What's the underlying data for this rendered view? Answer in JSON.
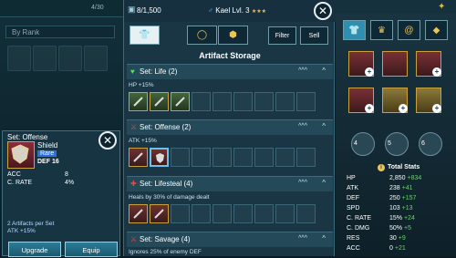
{
  "left_panel": {
    "top_counter": "4/30",
    "sort_label": "By Rank"
  },
  "detail": {
    "title": "Set: Offense",
    "item_name": "Shield",
    "rarity": "Rare",
    "main_stat": "DEF 16",
    "stats": [
      {
        "label": "ACC",
        "value": "8"
      },
      {
        "label": "C. RATE",
        "value": "4%"
      }
    ],
    "set_pieces": "2 Artifacts per Set",
    "set_bonus": "ATK +15%",
    "upgrade_label": "Upgrade",
    "equip_label": "Equip",
    "close_glyph": "✕"
  },
  "storage": {
    "bag_count": "8/1,500",
    "champion": "Kael Lvl. 3",
    "champion_stars": "★★★",
    "close_glyph": "✕",
    "filter_label": "Filter",
    "sell_label": "Sell",
    "title": "Artifact Storage",
    "sets": [
      {
        "name": "Set: Life (2)",
        "bonus": "HP +15%",
        "icon": "heart-icon",
        "icon_color": "#5fdc5f"
      },
      {
        "name": "Set: Offense (2)",
        "bonus": "ATK +15%",
        "icon": "sword-icon",
        "icon_color": "#e44b4b"
      },
      {
        "name": "Set: Lifesteal (4)",
        "bonus": "Heals by 30% of damage dealt",
        "icon": "drop-icon",
        "icon_color": "#e44b4b"
      },
      {
        "name": "Set: Savage (4)",
        "bonus": "Ignores 25% of enemy DEF",
        "icon": "sword-icon",
        "icon_color": "#e44b4b"
      }
    ],
    "row_arrows": "^^^",
    "row_chevron": "^"
  },
  "hero": {
    "relics": [
      "4",
      "5",
      "6"
    ],
    "total_stats_label": "Total Stats",
    "stats": [
      {
        "label": "HP",
        "base": "2,850",
        "bonus": "+834",
        "bonus_color": "green"
      },
      {
        "label": "ATK",
        "base": "238",
        "bonus": "+41",
        "bonus_color": "green"
      },
      {
        "label": "DEF",
        "base": "250",
        "bonus": "+157",
        "bonus_color": "green"
      },
      {
        "label": "SPD",
        "base": "103",
        "bonus": "+13",
        "bonus_color": "green"
      },
      {
        "label": "C. RATE",
        "base": "15%",
        "bonus": "+24",
        "bonus_color": "green"
      },
      {
        "label": "C. DMG",
        "base": "50%",
        "bonus": "+5",
        "bonus_color": "green"
      },
      {
        "label": "RES",
        "base": "30",
        "bonus": "+9",
        "bonus_color": "green"
      },
      {
        "label": "ACC",
        "base": "0",
        "bonus": "+21",
        "bonus_color": "green"
      }
    ]
  },
  "colors": {
    "accent": "#2f8fb0",
    "gold": "#c8a13d",
    "positive": "#5fdc5f",
    "negative": "#e44b4b"
  }
}
